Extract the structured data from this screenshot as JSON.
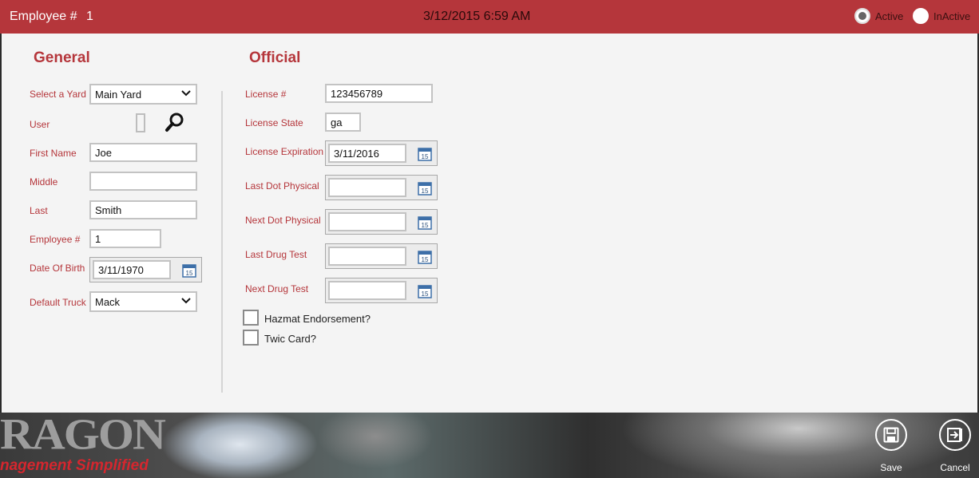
{
  "header": {
    "employee_label": "Employee #",
    "employee_number": "1",
    "datetime": "3/12/2015 6:59 AM",
    "status_options": [
      {
        "label": "Active",
        "checked": true
      },
      {
        "label": "InActive",
        "checked": false
      }
    ]
  },
  "general": {
    "title": "General",
    "yard_label": "Select a Yard",
    "yard_value": "Main Yard",
    "user_label": "User",
    "first_name_label": "First Name",
    "first_name_value": "Joe",
    "middle_label": "Middle",
    "middle_value": "",
    "last_label": "Last",
    "last_value": "Smith",
    "employee_number_label": "Employee #",
    "employee_number_value": "1",
    "dob_label": "Date Of Birth",
    "dob_value": "3/11/1970",
    "default_truck_label": "Default Truck",
    "default_truck_value": "Mack"
  },
  "official": {
    "title": "Official",
    "license_label": "License #",
    "license_value": "123456789",
    "license_state_label": "License State",
    "license_state_value": "ga",
    "license_expiration_label": "License Expiration",
    "license_expiration_value": "3/11/2016",
    "last_dot_physical_label": "Last Dot Physical",
    "last_dot_physical_value": "",
    "next_dot_physical_label": "Next Dot Physical",
    "next_dot_physical_value": "",
    "last_drug_test_label": "Last Drug Test",
    "last_drug_test_value": "",
    "next_drug_test_label": "Next Drug Test",
    "next_drug_test_value": "",
    "hazmat_label": "Hazmat Endorsement?",
    "twic_label": "Twic Card?"
  },
  "calendar_day": "15",
  "banner": {
    "brand_line1": "RAGON",
    "brand_line2": "nagement Simplified"
  },
  "actions": {
    "save_label": "Save",
    "cancel_label": "Cancel"
  },
  "colors": {
    "header": "#b5363b",
    "label": "#b5363b",
    "panel": "#f4f4f4"
  }
}
